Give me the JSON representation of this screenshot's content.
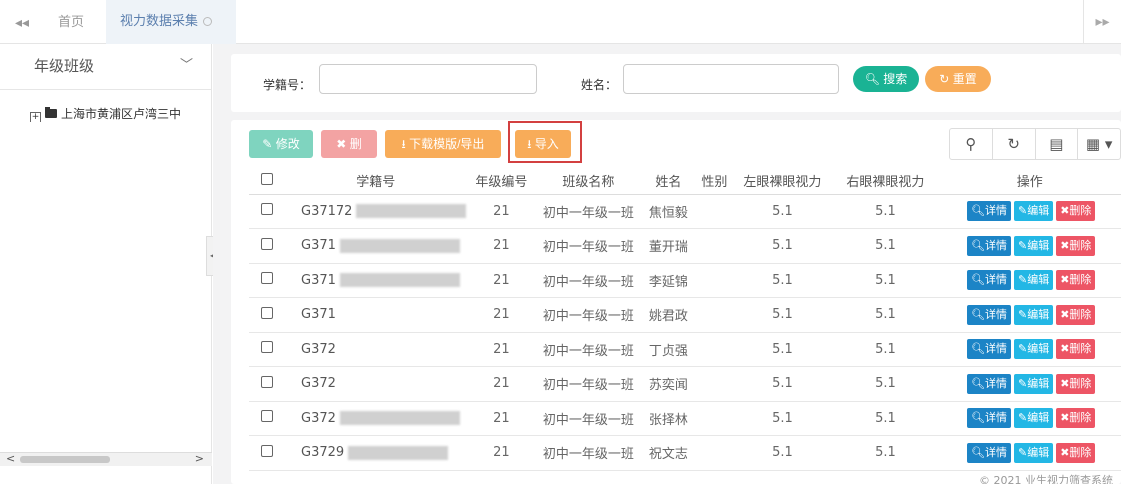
{
  "tabs": {
    "nav_left": "◂◂",
    "home": "首页",
    "active": "视力数据采集",
    "nav_right": "▸▸"
  },
  "sidebar": {
    "title": "年级班级",
    "tree_root": "上海市黄浦区卢湾三中"
  },
  "search": {
    "id_label": "学籍号：",
    "id_value": "",
    "name_label": "姓名：",
    "name_value": "",
    "search_button": "搜索",
    "reset_button": "重置"
  },
  "toolbar": {
    "edit": "修改",
    "delete": "删除",
    "template_export": "下载模版/导出",
    "import": "导入"
  },
  "table": {
    "columns": [
      "学籍号",
      "年级编号",
      "班级名称",
      "姓名",
      "性别",
      "左眼裸眼视力",
      "右眼裸眼视力",
      "操作"
    ],
    "ops": {
      "detail": "详情",
      "edit": "编辑",
      "delete": "删除"
    },
    "rows": [
      {
        "student_id": "G37172",
        "grade": "21",
        "class": "初中一年级一班",
        "name": "焦恒毅",
        "gender": "",
        "left": "5.1",
        "right": "5.1"
      },
      {
        "student_id": "G371",
        "grade": "21",
        "class": "初中一年级一班",
        "name": "董开瑞",
        "gender": "",
        "left": "5.1",
        "right": "5.1"
      },
      {
        "student_id": "G371",
        "grade": "21",
        "class": "初中一年级一班",
        "name": "李延锦",
        "gender": "",
        "left": "5.1",
        "right": "5.1"
      },
      {
        "student_id": "G371",
        "grade": "21",
        "class": "初中一年级一班",
        "name": "姚君政",
        "gender": "",
        "left": "5.1",
        "right": "5.1"
      },
      {
        "student_id": "G372",
        "grade": "21",
        "class": "初中一年级一班",
        "name": "丁贞强",
        "gender": "",
        "left": "5.1",
        "right": "5.1"
      },
      {
        "student_id": "G372",
        "grade": "21",
        "class": "初中一年级一班",
        "name": "苏奕闻",
        "gender": "",
        "left": "5.1",
        "right": "5.1"
      },
      {
        "student_id": "G372",
        "grade": "21",
        "class": "初中一年级一班",
        "name": "张择林",
        "gender": "",
        "left": "5.1",
        "right": "5.1"
      },
      {
        "student_id": "G3729",
        "grade": "21",
        "class": "初中一年级一班",
        "name": "祝文志",
        "gender": "",
        "left": "5.1",
        "right": "5.1"
      }
    ]
  },
  "footer": "© 2021 业生视力筛查系统",
  "colors": {
    "primary": "#1c84c6",
    "success": "#1ab394",
    "warning": "#f8ac59",
    "danger": "#ed5565",
    "info": "#23b7e5",
    "highlight": "#d34040"
  }
}
